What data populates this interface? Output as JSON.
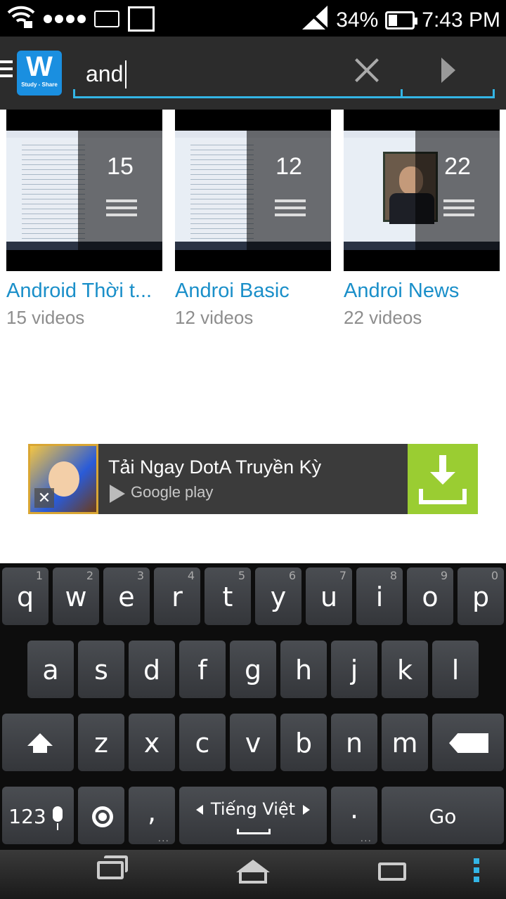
{
  "status_bar": {
    "battery": "34%",
    "time": "7:43 PM"
  },
  "action_bar": {
    "logo_text": "Study - Share",
    "search_value": "and"
  },
  "playlists": [
    {
      "title": "Android Thời t...",
      "subtitle": "15 videos",
      "count": "15"
    },
    {
      "title": "Androi Basic",
      "subtitle": "12 videos",
      "count": "12"
    },
    {
      "title": "Androi News",
      "subtitle": "22 videos",
      "count": "22"
    }
  ],
  "ad": {
    "title": "Tải Ngay DotA Truyền Kỳ",
    "store": "Google play",
    "close": "✕"
  },
  "keyboard": {
    "row1": [
      {
        "ch": "q",
        "num": "1"
      },
      {
        "ch": "w",
        "num": "2"
      },
      {
        "ch": "e",
        "num": "3"
      },
      {
        "ch": "r",
        "num": "4"
      },
      {
        "ch": "t",
        "num": "5"
      },
      {
        "ch": "y",
        "num": "6"
      },
      {
        "ch": "u",
        "num": "7"
      },
      {
        "ch": "i",
        "num": "8"
      },
      {
        "ch": "o",
        "num": "9"
      },
      {
        "ch": "p",
        "num": "0"
      }
    ],
    "row2": [
      "a",
      "s",
      "d",
      "f",
      "g",
      "h",
      "j",
      "k",
      "l"
    ],
    "row3": [
      "z",
      "x",
      "c",
      "v",
      "b",
      "n",
      "m"
    ],
    "symbols_label": "123",
    "comma": ",",
    "language": "Tiếng Việt",
    "period": ".",
    "go_label": "Go"
  }
}
